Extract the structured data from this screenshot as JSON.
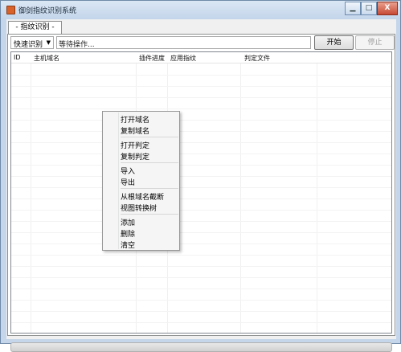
{
  "window": {
    "title": "御剑指纹识别系统",
    "controls": {
      "minimize": "▁",
      "maximize": "□",
      "close": "X"
    }
  },
  "tab": {
    "label": "- 指纹识别 -"
  },
  "toolbar": {
    "mode_select": "快速识别",
    "status": "等待操作...",
    "start_label": "开始",
    "stop_label": "停止"
  },
  "table": {
    "columns": [
      "ID",
      "主机域名",
      "插件进度",
      "应用指纹",
      "判定文件"
    ],
    "rows": []
  },
  "context_menu": {
    "items": [
      "打开域名",
      "复制域名",
      "打开判定",
      "复制判定",
      "导入",
      "导出",
      "从根域名截断",
      "视图转换树",
      "添加",
      "删除",
      "清空"
    ]
  }
}
